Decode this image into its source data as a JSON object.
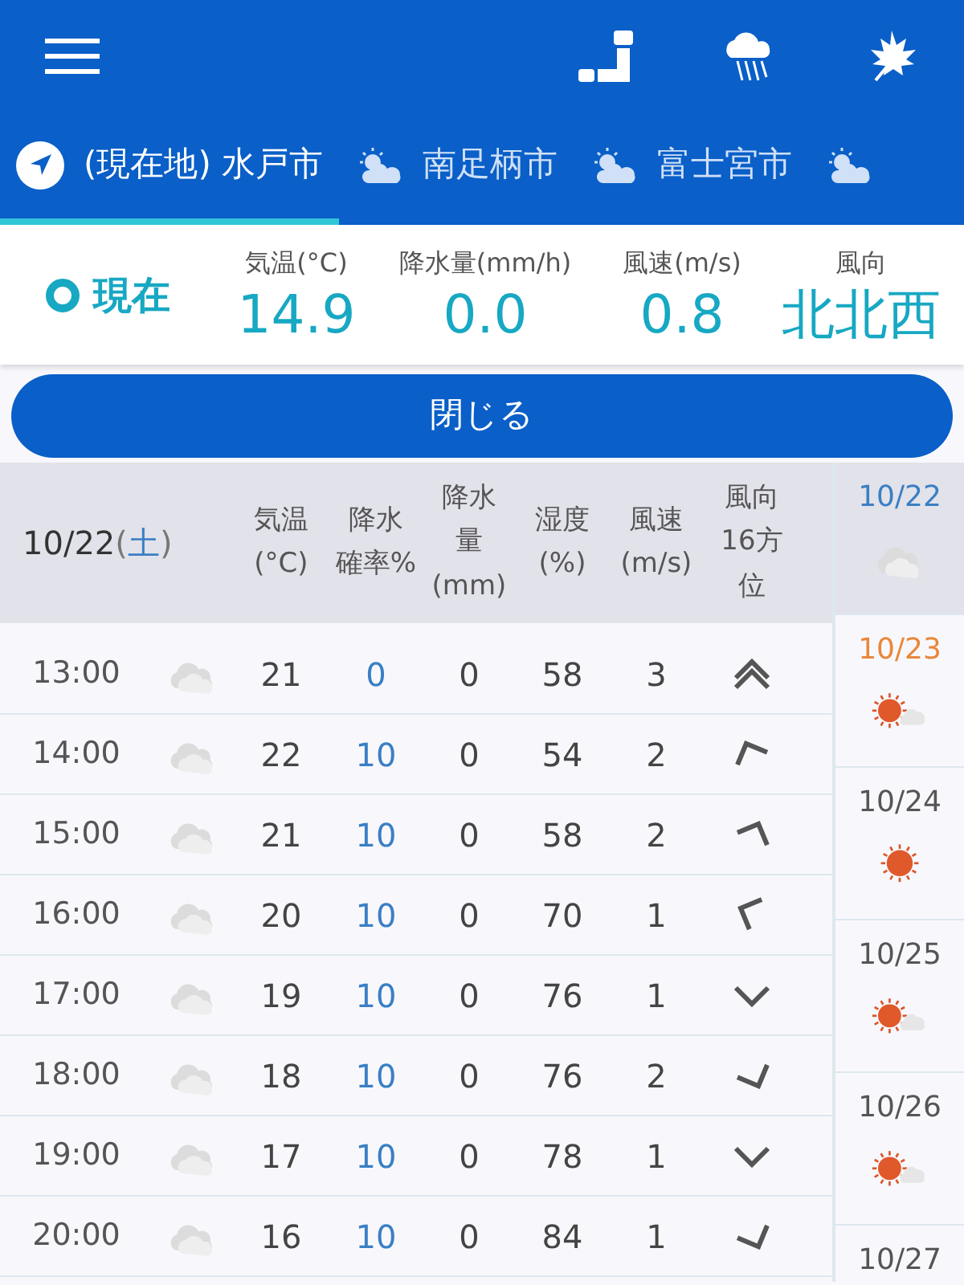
{
  "tabs": [
    {
      "kind": "location",
      "label": "(現在地) 水戸市",
      "selected": true
    },
    {
      "kind": "weather",
      "label": "南足柄市",
      "selected": false
    },
    {
      "kind": "weather",
      "label": "富士宮市",
      "selected": false
    },
    {
      "kind": "weather",
      "selected": false
    }
  ],
  "current": {
    "label": "現在",
    "readings": [
      {
        "heading": "気温(°C)",
        "value": "14.9"
      },
      {
        "heading": "降水量(mm/h)",
        "value": "0.0"
      },
      {
        "heading": "風速(m/s)",
        "value": "0.8"
      },
      {
        "heading": "風向",
        "value": "北北西"
      }
    ]
  },
  "close_button": "閉じる",
  "table": {
    "date_heading": {
      "date": "10/22",
      "open": "(",
      "weekday": "土",
      "close": ")"
    },
    "columns": [
      [
        "気温",
        "(°C)"
      ],
      [
        "降水",
        "確率%"
      ],
      [
        "降水",
        "量",
        "(mm)"
      ],
      [
        "湿度",
        "(%)"
      ],
      [
        "風速",
        "(m/s)"
      ],
      [
        "風向",
        "16方",
        "位"
      ]
    ],
    "rows": [
      {
        "time": "13:00",
        "kind": "cloudy",
        "temp": "21",
        "rain_chance": "0",
        "rain_amount": "0",
        "humidity": "58",
        "wind_speed": "3",
        "wind_arrow": {
          "kind": "nstrong"
        }
      },
      {
        "time": "14:00",
        "kind": "cloudy",
        "temp": "22",
        "rain_chance": "10",
        "rain_amount": "0",
        "humidity": "54",
        "wind_speed": "2",
        "wind_arrow": {
          "kind": "nnw"
        }
      },
      {
        "time": "15:00",
        "kind": "cloudy",
        "temp": "21",
        "rain_chance": "10",
        "rain_amount": "0",
        "humidity": "58",
        "wind_speed": "2",
        "wind_arrow": {
          "kind": "nne"
        }
      },
      {
        "time": "16:00",
        "kind": "cloudy",
        "temp": "20",
        "rain_chance": "10",
        "rain_amount": "0",
        "humidity": "70",
        "wind_speed": "1",
        "wind_arrow": {
          "kind": "wnw"
        }
      },
      {
        "time": "17:00",
        "kind": "cloudy",
        "temp": "19",
        "rain_chance": "10",
        "rain_amount": "0",
        "humidity": "76",
        "wind_speed": "1",
        "wind_arrow": {
          "kind": "s"
        }
      },
      {
        "time": "18:00",
        "kind": "cloudy",
        "temp": "18",
        "rain_chance": "10",
        "rain_amount": "0",
        "humidity": "76",
        "wind_speed": "2",
        "wind_arrow": {
          "kind": "sse"
        }
      },
      {
        "time": "19:00",
        "kind": "cloudy",
        "temp": "17",
        "rain_chance": "10",
        "rain_amount": "0",
        "humidity": "78",
        "wind_speed": "1",
        "wind_arrow": {
          "kind": "s"
        }
      },
      {
        "time": "20:00",
        "kind": "cloudy",
        "temp": "16",
        "rain_chance": "10",
        "rain_amount": "0",
        "humidity": "84",
        "wind_speed": "1",
        "wind_arrow": {
          "kind": "sse"
        }
      }
    ]
  },
  "days": [
    {
      "date": "10/22",
      "color": "#3a7fc4",
      "kind": "cloudy",
      "selected": true
    },
    {
      "date": "10/23",
      "color": "#e8873a",
      "kind": "sunny-cloudy",
      "selected": false
    },
    {
      "date": "10/24",
      "color": "#555555",
      "kind": "sunny",
      "selected": false
    },
    {
      "date": "10/25",
      "color": "#555555",
      "kind": "sunny-cloudy",
      "selected": false
    },
    {
      "date": "10/26",
      "color": "#555555",
      "kind": "sunny-cloudy",
      "selected": false
    },
    {
      "date": "10/27",
      "color": "#555555",
      "selected": false
    }
  ]
}
